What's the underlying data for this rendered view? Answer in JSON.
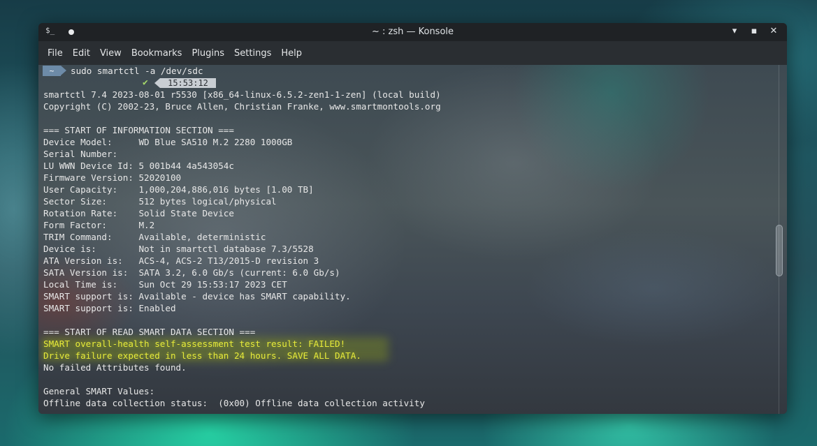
{
  "window": {
    "title": "~ : zsh — Konsole",
    "terminal_icon": "$_",
    "buttons": {
      "minimize": "▾",
      "maximize": "▪",
      "close": "✕"
    }
  },
  "menu": [
    "File",
    "Edit",
    "View",
    "Bookmarks",
    "Plugins",
    "Settings",
    "Help"
  ],
  "prompt": {
    "dir": "~",
    "command": "sudo smartctl -a /dev/sdc",
    "status_icon": "✔",
    "time": "15:53:12"
  },
  "output": [
    "smartctl 7.4 2023-08-01 r5530 [x86_64-linux-6.5.2-zen1-1-zen] (local build)",
    "Copyright (C) 2002-23, Bruce Allen, Christian Franke, www.smartmontools.org",
    "",
    "=== START OF INFORMATION SECTION ===",
    "Device Model:     WD Blue SA510 M.2 2280 1000GB",
    "Serial Number:    ",
    "LU WWN Device Id: 5 001b44 4a543054c",
    "Firmware Version: 52020100",
    "User Capacity:    1,000,204,886,016 bytes [1.00 TB]",
    "Sector Size:      512 bytes logical/physical",
    "Rotation Rate:    Solid State Device",
    "Form Factor:      M.2",
    "TRIM Command:     Available, deterministic",
    "Device is:        Not in smartctl database 7.3/5528",
    "ATA Version is:   ACS-4, ACS-2 T13/2015-D revision 3",
    "SATA Version is:  SATA 3.2, 6.0 Gb/s (current: 6.0 Gb/s)",
    "Local Time is:    Sun Oct 29 15:53:17 2023 CET",
    "SMART support is: Available - device has SMART capability.",
    "SMART support is: Enabled",
    "",
    "=== START OF READ SMART DATA SECTION ===",
    "SMART overall-health self-assessment test result: FAILED!",
    "Drive failure expected in less than 24 hours. SAVE ALL DATA.",
    "No failed Attributes found.",
    "",
    "General SMART Values:",
    "Offline data collection status:  (0x00) Offline data collection activity"
  ],
  "colors": {
    "warning": "#e6ea3a",
    "prompt_bg": "#6d8ba8",
    "titlebar": "#1f2225"
  }
}
